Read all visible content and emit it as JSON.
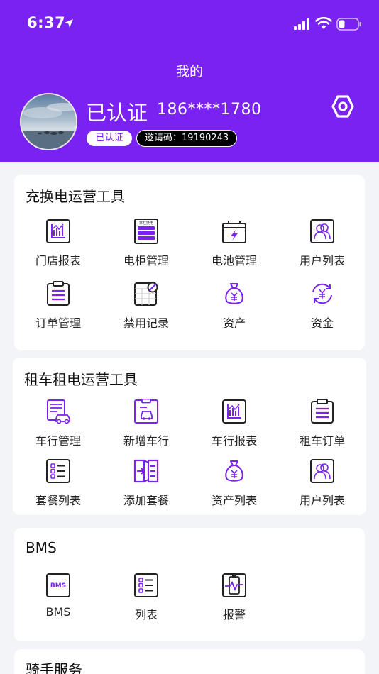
{
  "status_bar": {
    "time": "6:37"
  },
  "header": {
    "title": "我的",
    "username": "已认证",
    "phone": "186****1780",
    "verify_badge": "已认证",
    "invite_code": "邀请码：19190243"
  },
  "sections": [
    {
      "title": "充换电运营工具",
      "items": [
        {
          "label": "门店报表",
          "icon": "store-report-icon"
        },
        {
          "label": "电柜管理",
          "icon": "cabinet-icon",
          "icon_text": "掌柱换电"
        },
        {
          "label": "电池管理",
          "icon": "battery-manage-icon"
        },
        {
          "label": "用户列表",
          "icon": "user-list-icon"
        },
        {
          "label": "订单管理",
          "icon": "order-icon"
        },
        {
          "label": "禁用记录",
          "icon": "disable-record-icon"
        },
        {
          "label": "资产",
          "icon": "asset-bag-icon"
        },
        {
          "label": "资金",
          "icon": "funds-icon"
        }
      ]
    },
    {
      "title": "租车租电运营工具",
      "items": [
        {
          "label": "车行管理",
          "icon": "dealer-manage-icon"
        },
        {
          "label": "新增车行",
          "icon": "add-dealer-icon"
        },
        {
          "label": "车行报表",
          "icon": "dealer-report-icon"
        },
        {
          "label": "租车订单",
          "icon": "rental-order-icon"
        },
        {
          "label": "套餐列表",
          "icon": "package-list-icon"
        },
        {
          "label": "添加套餐",
          "icon": "add-package-icon"
        },
        {
          "label": "资产列表",
          "icon": "asset-list-icon"
        },
        {
          "label": "用户列表",
          "icon": "user-list-icon"
        }
      ]
    },
    {
      "title": "BMS",
      "items": [
        {
          "label": "BMS",
          "icon": "bms-icon",
          "icon_text": "BMS"
        },
        {
          "label": "列表",
          "icon": "list-icon"
        },
        {
          "label": "报警",
          "icon": "alarm-icon"
        }
      ]
    },
    {
      "title": "骑手服务",
      "items": []
    }
  ],
  "colors": {
    "brand": "#7a22f2",
    "background": "#f3f4f8",
    "card": "#ffffff"
  }
}
